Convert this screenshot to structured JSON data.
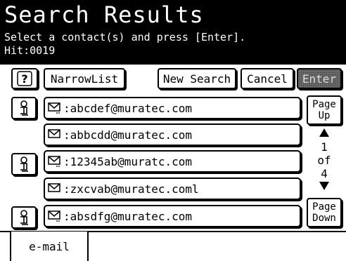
{
  "header": {
    "title": "Search Results",
    "instruction": "Select a contact(s) and press [Enter].",
    "hit": "Hit:0019"
  },
  "toolbar": {
    "help_icon": "question-mark-icon",
    "narrow_list_label": "NarrowList",
    "new_search_label": "New Search",
    "cancel_label": "Cancel",
    "enter_label": "Enter"
  },
  "results": [
    {
      "email": "abcdef@muratec.com",
      "has_info": true
    },
    {
      "email": "abbcdd@muratec.com",
      "has_info": false
    },
    {
      "email": "12345ab@muratc.com",
      "has_info": true
    },
    {
      "email": "zxcvab@muratec.coml",
      "has_info": false
    },
    {
      "email": "absdfg@muratec.com",
      "has_info": true
    }
  ],
  "row_prefix": ":",
  "pager": {
    "page_up_line1": "Page",
    "page_up_line2": "Up",
    "current": "1",
    "of": "of",
    "total": "4",
    "page_down_line1": "Page",
    "page_down_line2": "Down"
  },
  "tabs": [
    {
      "label": "e-mail",
      "active": true
    }
  ]
}
